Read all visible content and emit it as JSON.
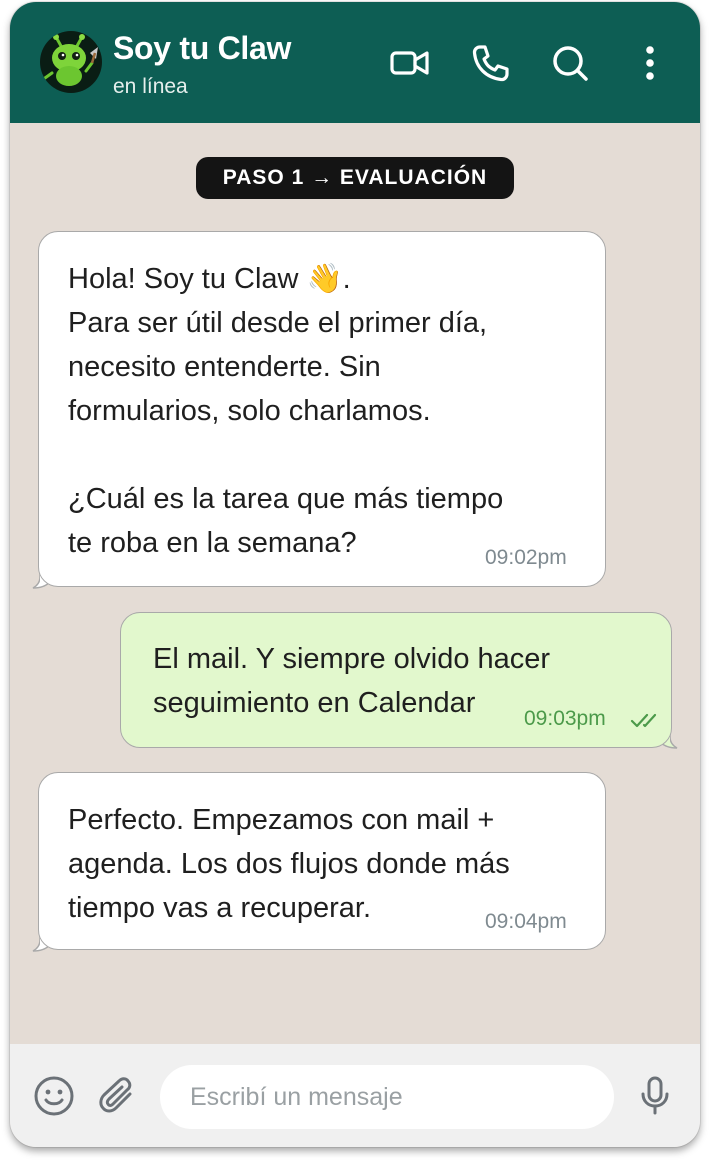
{
  "header": {
    "contact_name": "Soy tu Claw",
    "contact_status": "en línea",
    "icons": [
      "avatar-bug",
      "video-icon",
      "phone-icon",
      "search-icon",
      "more-vert-icon"
    ]
  },
  "chat": {
    "step_badge": "PASO 1 → EVALUACIÓN",
    "messages": [
      {
        "direction": "incoming",
        "text": "Hola! Soy tu Claw 👋.\nPara ser útil desde el primer día,\nnecesito entenderte. Sin\nformularios, solo charlamos.\n\n¿Cuál es la tarea que más tiempo\nte roba en la semana?",
        "time": "09:02pm"
      },
      {
        "direction": "outgoing",
        "text": "El mail. Y siempre olvido hacer\nseguimiento en Calendar",
        "time": "09:03pm",
        "status_icon": "double-check-icon"
      },
      {
        "direction": "incoming",
        "text": "Perfecto. Empezamos con mail +\nagenda. Los dos flujos donde más\ntiempo vas a recuperar.",
        "time": "09:04pm"
      }
    ]
  },
  "composer": {
    "placeholder": "Escribí un mensaje",
    "icons": [
      "emoji-icon",
      "attach-icon",
      "mic-icon"
    ]
  },
  "colors": {
    "header": "#0d5e54",
    "chat_background": "#e4dcd5",
    "incoming_bubble": "#ffffff",
    "outgoing_bubble": "#e2f8cd",
    "outgoing_time": "#4c9a4a",
    "badge": "#141414",
    "composer_background": "#f0f0f0"
  }
}
